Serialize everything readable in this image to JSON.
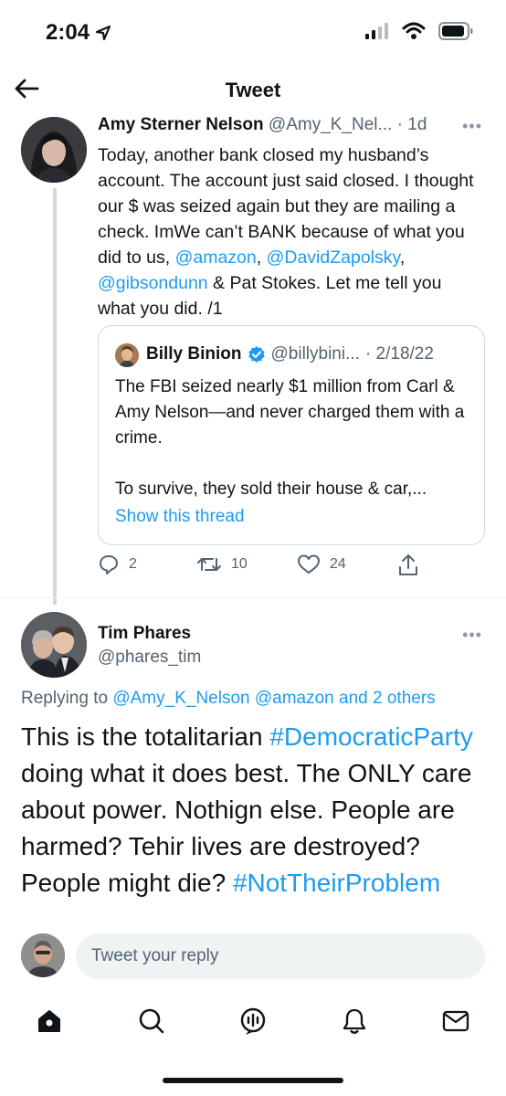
{
  "status_bar": {
    "time": "2:04"
  },
  "header": {
    "title": "Tweet"
  },
  "tweet1": {
    "name": "Amy Sterner Nelson",
    "handle": "@Amy_K_Nel...",
    "time": "· 1d",
    "text_parts": {
      "t1": "Today, another bank closed my husband’s account. The account just said closed. I thought our $ was seized again but they are mailing a check. ImWe can’t BANK because of what you did to us, ",
      "m1": "@amazon",
      "t2": ", ",
      "m2": "@DavidZapolsky",
      "t3": ", ",
      "m3": "@gibsondunn",
      "t4": " & Pat Stokes. Let me tell you what you did. /1"
    },
    "actions": {
      "replies": "2",
      "retweets": "10",
      "likes": "24"
    }
  },
  "quote": {
    "name": "Billy Binion",
    "handle": "@billybini...",
    "date": "· 2/18/22",
    "text1": "The FBI seized nearly $1 million from Carl & Amy Nelson—and never charged them with a crime.",
    "text2": "To survive, they sold their house & car,...",
    "show_thread": "Show this thread"
  },
  "tweet2": {
    "name": "Tim Phares",
    "handle": "@phares_tim",
    "replying_prefix": "Replying to ",
    "replying_users": "@Amy_K_Nelson @amazon and 2 others",
    "text_parts": {
      "t1": "This is the totalitarian ",
      "h1": "#DemocraticParty",
      "t2": " doing what it does best.  The ONLY care about power.  Nothign else.  People are harmed?  Tehir lives are destroyed?  People might die?  ",
      "h2": "#NotTheirProblem"
    }
  },
  "reply_bar": {
    "placeholder": "Tweet your reply"
  },
  "tabs": [
    "home-icon",
    "search-icon",
    "spaces-icon",
    "notifications-icon",
    "messages-icon"
  ],
  "colors": {
    "accent": "#1d9bf0",
    "text": "#0f1419",
    "secondary": "#536471"
  }
}
